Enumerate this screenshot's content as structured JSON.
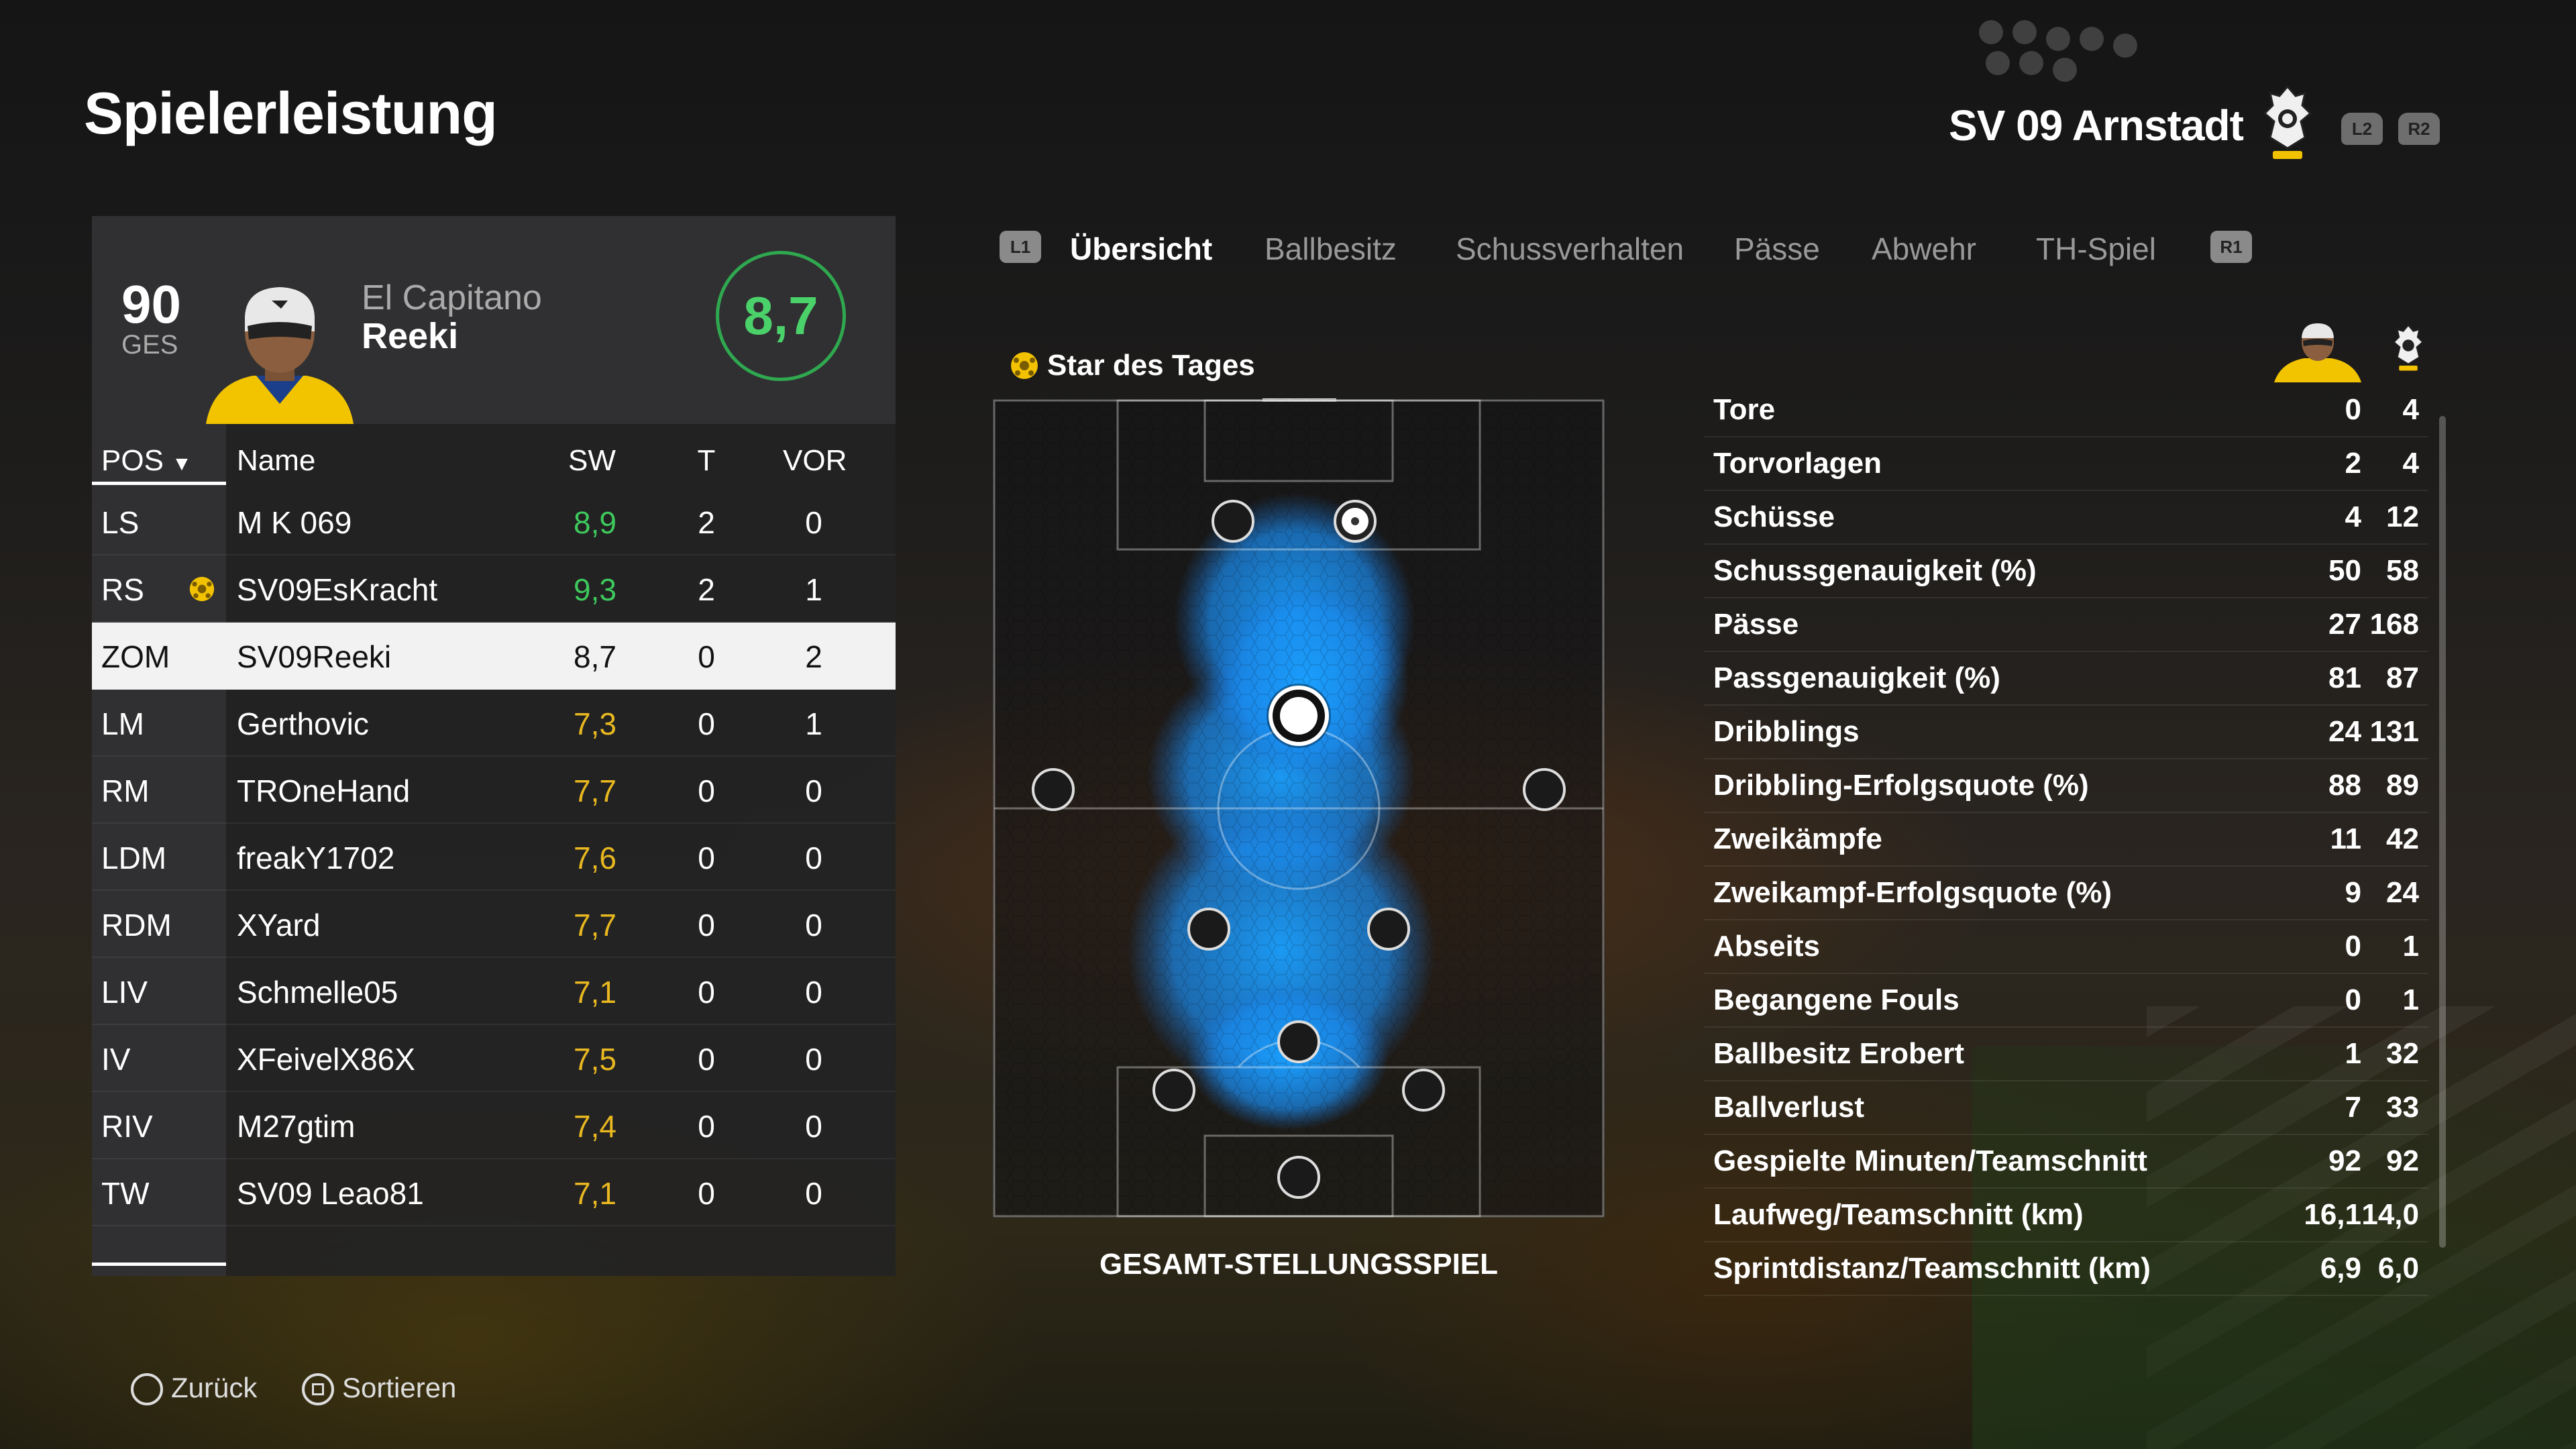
{
  "page_title": "Spielerleistung",
  "team": {
    "name": "SV 09 Arnstadt"
  },
  "triggers": {
    "l2": "L2",
    "r2": "R2",
    "l1": "L1",
    "r1": "R1"
  },
  "player": {
    "overall": "90",
    "overall_label": "GES",
    "subtitle": "El Capitano",
    "name": "Reeki",
    "rating": "8,7"
  },
  "table": {
    "headers": {
      "pos": "POS",
      "name": "Name",
      "sw": "SW",
      "t": "T",
      "vor": "VOR"
    },
    "rows": [
      {
        "pos": "LS",
        "name": "M K 069",
        "sw": "8,9",
        "sw_color": "#3ec95c",
        "t": "2",
        "vor": "0",
        "star": false,
        "selected": false
      },
      {
        "pos": "RS",
        "name": "SV09EsKracht",
        "sw": "9,3",
        "sw_color": "#3ec95c",
        "t": "2",
        "vor": "1",
        "star": true,
        "selected": false
      },
      {
        "pos": "ZOM",
        "name": "SV09Reeki",
        "sw": "8,7",
        "sw_color": "#111111",
        "t": "0",
        "vor": "2",
        "star": false,
        "selected": true
      },
      {
        "pos": "LM",
        "name": "Gerthovic",
        "sw": "7,3",
        "sw_color": "#e9b820",
        "t": "0",
        "vor": "1",
        "star": false,
        "selected": false
      },
      {
        "pos": "RM",
        "name": "TROneHand",
        "sw": "7,7",
        "sw_color": "#e9b820",
        "t": "0",
        "vor": "0",
        "star": false,
        "selected": false
      },
      {
        "pos": "LDM",
        "name": "freakY1702",
        "sw": "7,6",
        "sw_color": "#e9b820",
        "t": "0",
        "vor": "0",
        "star": false,
        "selected": false
      },
      {
        "pos": "RDM",
        "name": "XYard",
        "sw": "7,7",
        "sw_color": "#e9b820",
        "t": "0",
        "vor": "0",
        "star": false,
        "selected": false
      },
      {
        "pos": "LIV",
        "name": "Schmelle05",
        "sw": "7,1",
        "sw_color": "#e9b820",
        "t": "0",
        "vor": "0",
        "star": false,
        "selected": false
      },
      {
        "pos": "IV",
        "name": "XFeivelX86X",
        "sw": "7,5",
        "sw_color": "#e9b820",
        "t": "0",
        "vor": "0",
        "star": false,
        "selected": false
      },
      {
        "pos": "RIV",
        "name": "M27gtim",
        "sw": "7,4",
        "sw_color": "#e9b820",
        "t": "0",
        "vor": "0",
        "star": false,
        "selected": false
      },
      {
        "pos": "TW",
        "name": "SV09 Leao81",
        "sw": "7,1",
        "sw_color": "#e9b820",
        "t": "0",
        "vor": "0",
        "star": false,
        "selected": false
      }
    ]
  },
  "tabs": [
    {
      "label": "Übersicht",
      "active": true
    },
    {
      "label": "Ballbesitz",
      "active": false
    },
    {
      "label": "Schussverhalten",
      "active": false
    },
    {
      "label": "Pässe",
      "active": false
    },
    {
      "label": "Abwehr",
      "active": false
    },
    {
      "label": "TH-Spiel",
      "active": false
    }
  ],
  "star_of_day_label": "Star des Tages",
  "pitch_caption": "GESAMT-STELLUNGSSPIEL",
  "stats": [
    {
      "label": "Tore",
      "player": "0",
      "team": "4"
    },
    {
      "label": "Torvorlagen",
      "player": "2",
      "team": "4"
    },
    {
      "label": "Schüsse",
      "player": "4",
      "team": "12"
    },
    {
      "label": "Schussgenauigkeit (%)",
      "player": "50",
      "team": "58"
    },
    {
      "label": "Pässe",
      "player": "27",
      "team": "168"
    },
    {
      "label": "Passgenauigkeit (%)",
      "player": "81",
      "team": "87"
    },
    {
      "label": "Dribblings",
      "player": "24",
      "team": "131"
    },
    {
      "label": "Dribbling-Erfolgsquote (%)",
      "player": "88",
      "team": "89"
    },
    {
      "label": "Zweikämpfe",
      "player": "11",
      "team": "42"
    },
    {
      "label": "Zweikampf-Erfolgsquote (%)",
      "player": "9",
      "team": "24"
    },
    {
      "label": "Abseits",
      "player": "0",
      "team": "1"
    },
    {
      "label": "Begangene Fouls",
      "player": "0",
      "team": "1"
    },
    {
      "label": "Ballbesitz Erobert",
      "player": "1",
      "team": "32"
    },
    {
      "label": "Ballverlust",
      "player": "7",
      "team": "33"
    },
    {
      "label": "Gespielte Minuten/Teamschnitt",
      "player": "92",
      "team": "92"
    },
    {
      "label": "Laufweg/Teamschnitt (km)",
      "player": "16,1",
      "team": "14,0"
    },
    {
      "label": "Sprintdistanz/Teamschnitt (km)",
      "player": "6,9",
      "team": "6,0"
    }
  ],
  "footer": {
    "back": "Zurück",
    "sort": "Sortieren"
  },
  "colors": {
    "accent_green": "#3ec95c",
    "rating_yellow": "#e9b820",
    "heatmap_blue": "#1e90ff"
  }
}
